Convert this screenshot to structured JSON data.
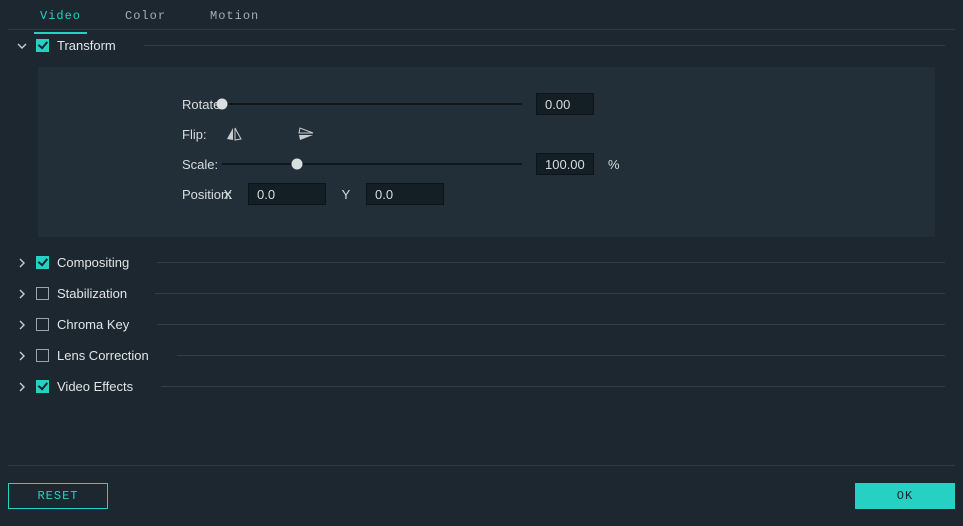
{
  "tabs": {
    "video": "Video",
    "color": "Color",
    "motion": "Motion",
    "active": "video"
  },
  "sections": {
    "transform": {
      "title": "Transform",
      "checked": true,
      "expanded": true
    },
    "compositing": {
      "title": "Compositing",
      "checked": true,
      "expanded": false
    },
    "stabilization": {
      "title": "Stabilization",
      "checked": false,
      "expanded": false
    },
    "chromaKey": {
      "title": "Chroma Key",
      "checked": false,
      "expanded": false
    },
    "lensCorrection": {
      "title": "Lens Correction",
      "checked": false,
      "expanded": false
    },
    "videoEffects": {
      "title": "Video Effects",
      "checked": true,
      "expanded": false
    }
  },
  "transform": {
    "rotateLabel": "Rotate:",
    "flipLabel": "Flip:",
    "scaleLabel": "Scale:",
    "positionLabel": "Position:",
    "rotateValue": "0.00",
    "scaleValue": "100.00",
    "scaleUnit": "%",
    "posXLabel": "X",
    "posYLabel": "Y",
    "posX": "0.0",
    "posY": "0.0",
    "rotateSliderPos": 0.0,
    "scaleSliderPos": 0.25
  },
  "footer": {
    "reset": "RESET",
    "ok": "OK"
  },
  "colors": {
    "accent": "#26d1c4",
    "bg": "#1c2730",
    "panelBg": "#222f39"
  }
}
